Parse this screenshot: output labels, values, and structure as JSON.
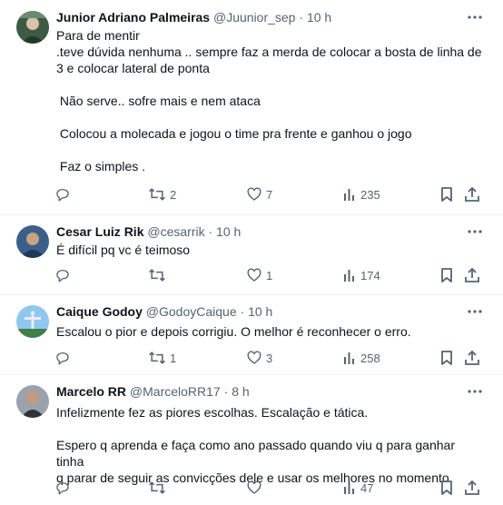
{
  "tweets": [
    {
      "name": "Junior Adriano Palmeiras",
      "handle": "@Juunior_sep",
      "separator": "·",
      "time": "10 h",
      "lines": [
        "Para de mentir",
        ".teve dúvida nenhuma .. sempre faz a merda de colocar a bosta de linha de",
        "3 e colocar lateral de ponta",
        "",
        " Não serve.. sofre mais e nem ataca",
        "",
        " Colocou a molecada e jogou o time pra frente e ganhou o jogo",
        "",
        " Faz o simples ."
      ],
      "replies": "",
      "retweets": "2",
      "likes": "7",
      "views": "235"
    },
    {
      "name": "Cesar Luiz Rik",
      "handle": "@cesarrik",
      "separator": "·",
      "time": "10 h",
      "lines": [
        "É difícil pq vc é teimoso"
      ],
      "replies": "",
      "retweets": "",
      "likes": "1",
      "views": "174"
    },
    {
      "name": "Caique Godoy",
      "handle": "@GodoyCaique",
      "separator": "·",
      "time": "10 h",
      "lines": [
        "Escalou o pior e depois corrigiu. O melhor é reconhecer o erro."
      ],
      "replies": "",
      "retweets": "1",
      "likes": "3",
      "views": "258"
    },
    {
      "name": "Marcelo RR",
      "handle": "@MarceloRR17",
      "separator": "·",
      "time": "8 h",
      "lines": [
        "Infelizmente fez as piores escolhas. Escalação e tática.",
        "",
        "Espero q aprenda e faça como ano passado quando viu q para ganhar tinha",
        "q parar de seguir as convicções dele e usar os melhores no momento"
      ],
      "replies": "",
      "retweets": "",
      "likes": "",
      "views": "47"
    }
  ],
  "colors": {
    "text": "#0f1419",
    "muted": "#536471",
    "divider": "#eff3f4"
  },
  "icons": [
    "more-icon",
    "reply-icon",
    "retweet-icon",
    "like-icon",
    "views-icon",
    "bookmark-icon",
    "share-icon"
  ]
}
